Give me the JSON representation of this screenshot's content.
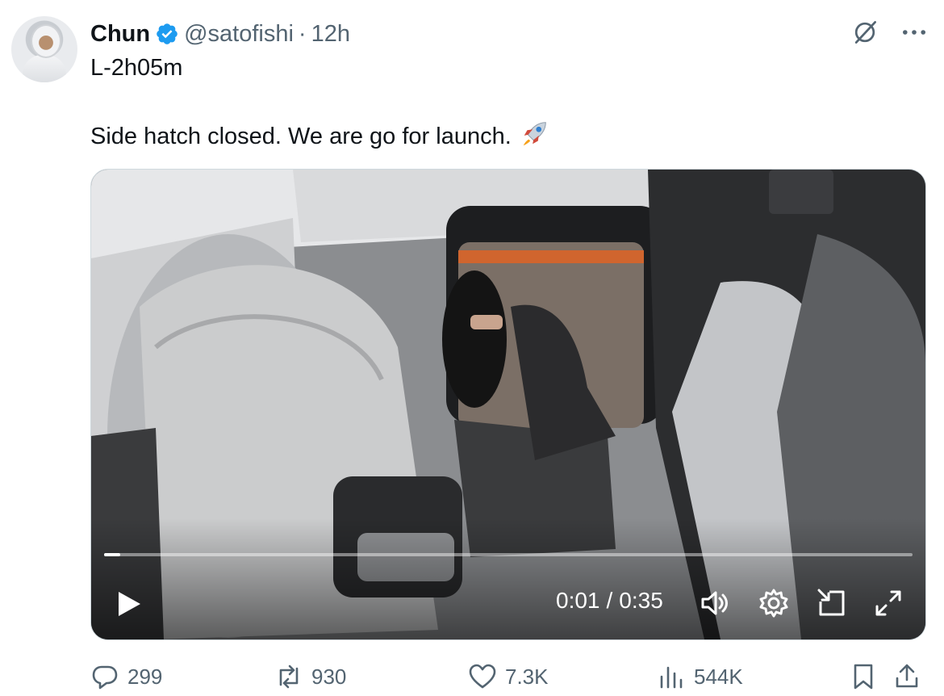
{
  "author": {
    "name": "Chun",
    "handle": "@satofishi",
    "separator": "·",
    "time": "12h",
    "avatar_icon": "astronaut-avatar"
  },
  "tweet": {
    "line1": "L-2h05m",
    "line2": "Side hatch closed. We are go for launch.",
    "emoji": "rocket-emoji"
  },
  "video": {
    "current_time": "0:01",
    "time_sep": "/",
    "duration": "0:35",
    "progress": 0.02,
    "controls": [
      "play-icon",
      "volume-icon",
      "settings-icon",
      "pip-icon",
      "fullscreen-icon"
    ]
  },
  "stats": {
    "replies": "299",
    "reposts": "930",
    "likes": "7.3K",
    "views": "544K"
  },
  "colors": {
    "text": "#0f1419",
    "muted": "#536471",
    "verified": "#1d9bf0",
    "border": "#cfd9de"
  }
}
